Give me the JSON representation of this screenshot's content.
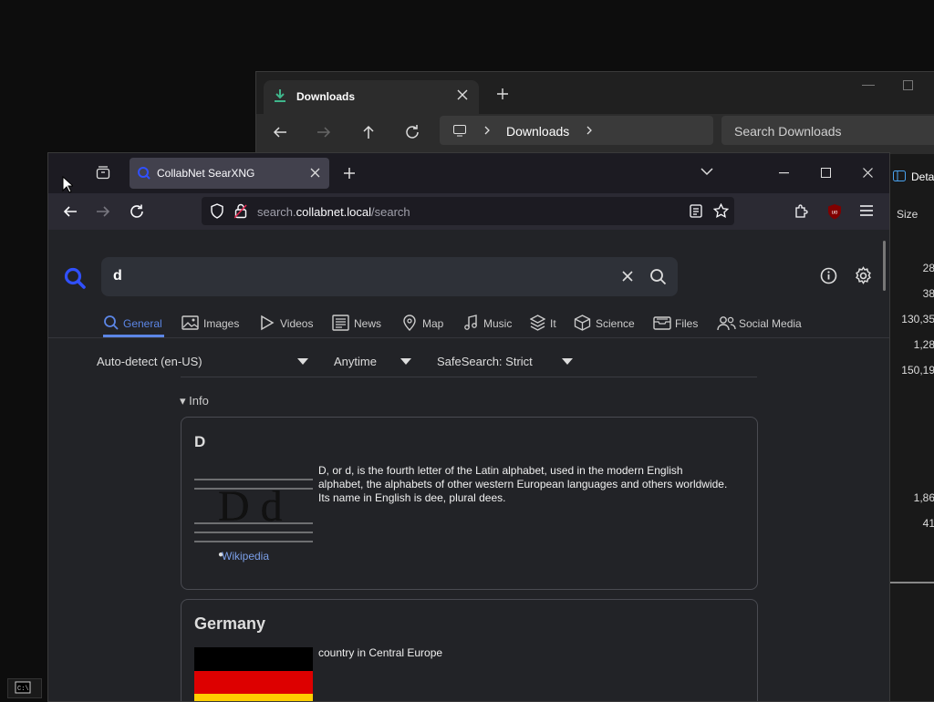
{
  "explorer": {
    "tab_label": "Downloads",
    "breadcrumb": "Downloads",
    "search_placeholder": "Search Downloads",
    "details_label": "Deta",
    "size_header": "Size",
    "sizes": [
      "28",
      "38",
      "130,35",
      "1,28",
      "150,19",
      "1,86",
      "41"
    ]
  },
  "browser": {
    "tab_title": "CollabNet SearXNG",
    "url_prefix": "search.",
    "url_domain": "collabnet.local",
    "url_path": "/search"
  },
  "search": {
    "query": "d",
    "categories": [
      {
        "label": "General"
      },
      {
        "label": "Images"
      },
      {
        "label": "Videos"
      },
      {
        "label": "News"
      },
      {
        "label": "Map"
      },
      {
        "label": "Music"
      },
      {
        "label": "It"
      },
      {
        "label": "Science"
      },
      {
        "label": "Files"
      },
      {
        "label": "Social Media"
      }
    ],
    "filters": {
      "language": "Auto-detect (en-US)",
      "time": "Anytime",
      "safesearch": "SafeSearch: Strict"
    },
    "info_toggle": "▾ Info",
    "infoboxes": [
      {
        "title": "D",
        "description": "D, or d, is the fourth letter of the Latin alphabet, used in the modern English alphabet, the alphabets of other western European languages and others worldwide. Its name in English is dee, plural dees.",
        "image_text": "D d",
        "link": "Wikipedia"
      },
      {
        "title": "Germany",
        "description": "country in Central Europe"
      }
    ]
  },
  "colors": {
    "accent": "#5c86e6",
    "page_bg": "#222327",
    "link": "#7b9fe8"
  }
}
